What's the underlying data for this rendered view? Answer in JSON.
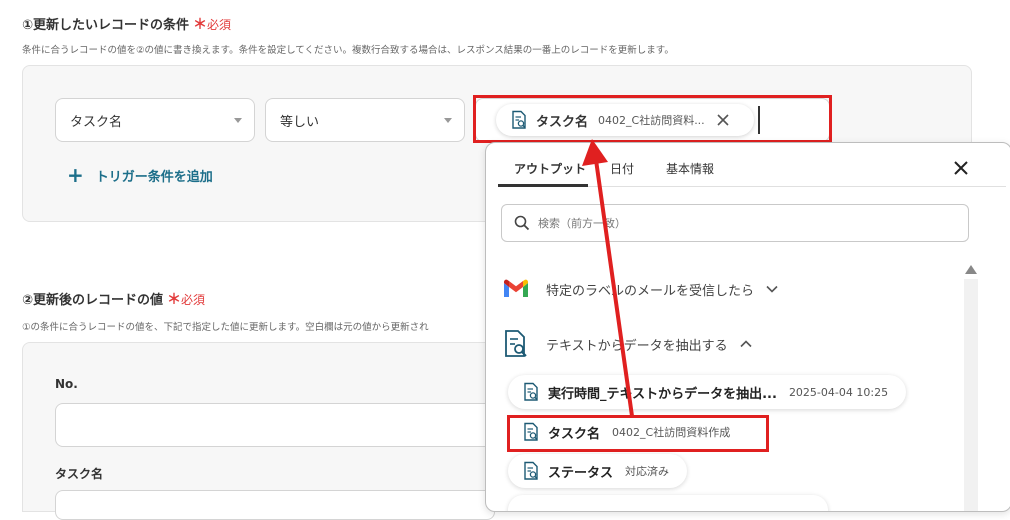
{
  "section1": {
    "title": "①更新したいレコードの条件",
    "required_star": "＊",
    "required_label": "必須",
    "description": "条件に合うレコードの値を②の値に書き換えます。条件を設定してください。複数行合致する場合は、レスポンス結果の一番上のレコードを更新します。",
    "field_select": "タスク名",
    "operator_select": "等しい",
    "value_chip": {
      "name": "タスク名",
      "value": "0402_C社訪問資料..."
    },
    "add_condition": "トリガー条件を追加"
  },
  "section2": {
    "title": "②更新後のレコードの値",
    "required_star": "＊",
    "required_label": "必須",
    "description": "①の条件に合うレコードの値を、下記で指定した値に更新します。空白欄は元の値から更新され",
    "fields": [
      {
        "label": "No."
      },
      {
        "label": "タスク名"
      }
    ]
  },
  "popup": {
    "tabs": [
      "アウトプット",
      "日付",
      "基本情報"
    ],
    "active_tab": "アウトプット",
    "search_placeholder": "検索（前方一致）",
    "groups": [
      {
        "title": "特定のラベルのメールを受信したら",
        "icon": "gmail-icon",
        "expanded": false
      },
      {
        "title": "テキストからデータを抽出する",
        "icon": "document-search-icon",
        "expanded": true
      }
    ],
    "items": [
      {
        "name": "実行時間_テキストからデータを抽出...",
        "value": "2025-04-04 10:25"
      },
      {
        "name": "タスク名",
        "value": "0402_C社訪問資料作成"
      },
      {
        "name": "ステータス",
        "value": "対応済み"
      }
    ]
  },
  "colors": {
    "accent": "#1d6f8a",
    "required": "#e23b3b",
    "highlight": "#e02020"
  }
}
